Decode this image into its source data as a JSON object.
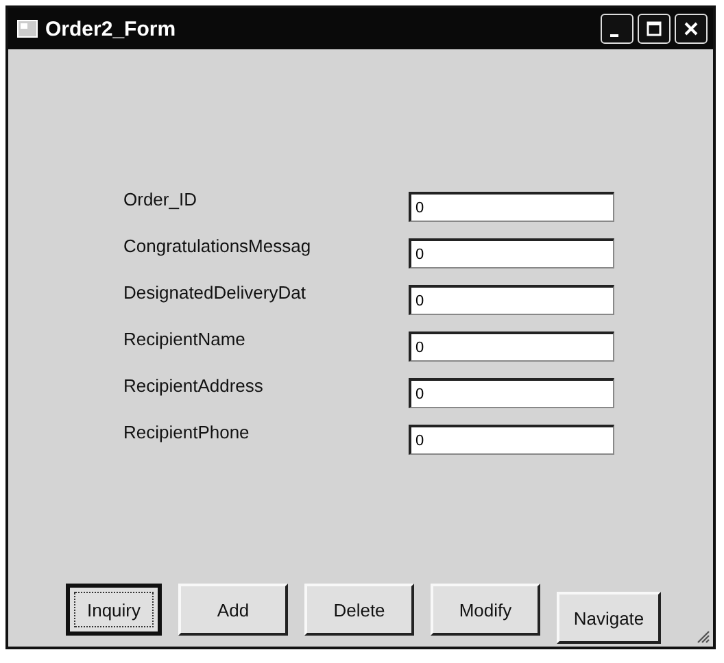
{
  "window": {
    "title": "Order2_Form"
  },
  "fields": [
    {
      "label": "Order_ID",
      "value": "0"
    },
    {
      "label": "CongratulationsMessag",
      "value": "0"
    },
    {
      "label": "DesignatedDeliveryDat",
      "value": "0"
    },
    {
      "label": "RecipientName",
      "value": "0"
    },
    {
      "label": "RecipientAddress",
      "value": "0"
    },
    {
      "label": "RecipientPhone",
      "value": "0"
    }
  ],
  "buttons": [
    {
      "label": "Inquiry",
      "focused": true
    },
    {
      "label": "Add",
      "focused": false
    },
    {
      "label": "Delete",
      "focused": false
    },
    {
      "label": "Modify",
      "focused": false
    },
    {
      "label": "Navigate",
      "focused": false
    }
  ]
}
